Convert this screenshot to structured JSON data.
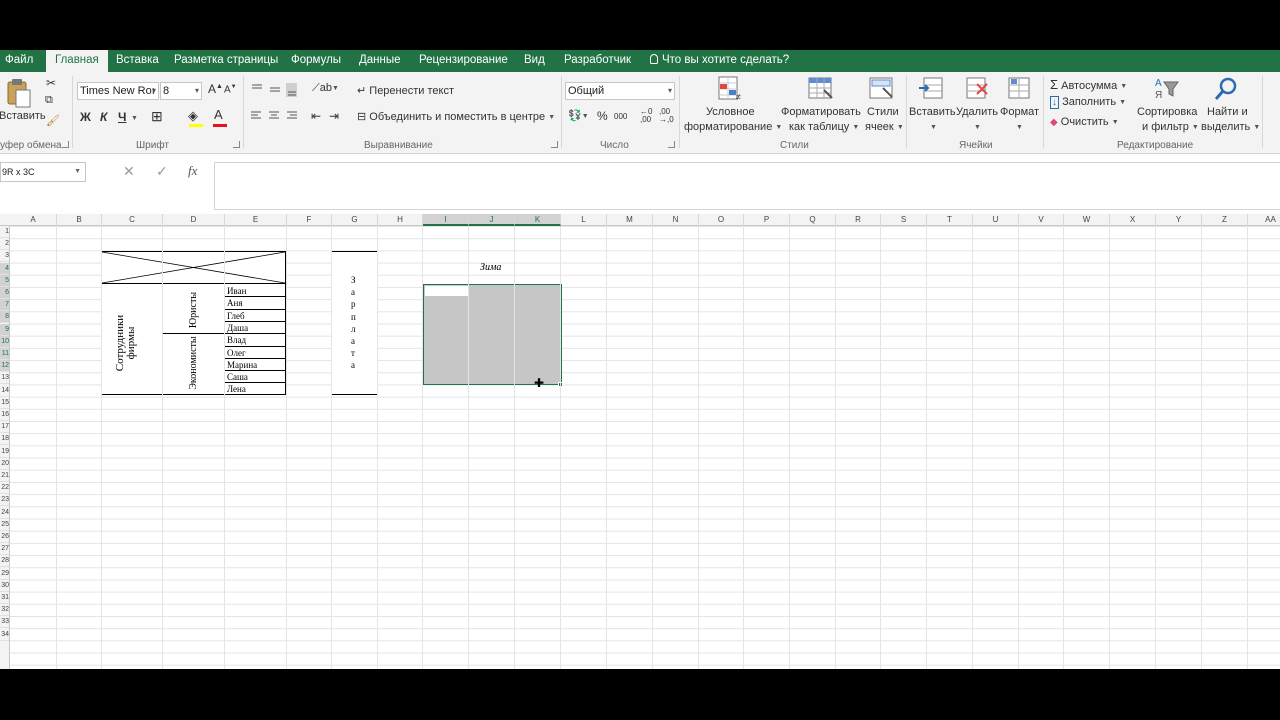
{
  "menu": {
    "tabs": [
      "Файл",
      "Главная",
      "Вставка",
      "Разметка страницы",
      "Формулы",
      "Данные",
      "Рецензирование",
      "Вид",
      "Разработчик"
    ],
    "active_index": 1,
    "tell_me": "Что вы хотите сделать?"
  },
  "ribbon": {
    "clipboard": {
      "paste": "Вставить",
      "group": "уфер обмена"
    },
    "font": {
      "name": "Times New Roı",
      "size": "8",
      "bold": "Ж",
      "italic": "К",
      "underline": "Ч",
      "group": "Шрифт"
    },
    "alignment": {
      "wrap": "Перенести текст",
      "merge": "Объединить и поместить в центре",
      "group": "Выравнивание"
    },
    "number": {
      "format": "Общий",
      "percent": "%",
      "thousands": "000",
      "group": "Число"
    },
    "styles": {
      "conditional_1": "Условное",
      "conditional_2": "форматирование",
      "format_table_1": "Форматировать",
      "format_table_2": "как таблицу",
      "cell_styles_1": "Стили",
      "cell_styles_2": "ячеек",
      "group": "Стили"
    },
    "cells": {
      "insert": "Вставить",
      "delete": "Удалить",
      "format": "Формат",
      "group": "Ячейки"
    },
    "editing": {
      "autosum": "Автосумма",
      "fill": "Заполнить",
      "clear": "Очистить",
      "sort_1": "Сортировка",
      "sort_2": "и фильтр",
      "find_1": "Найти и",
      "find_2": "выделить",
      "group": "Редактирование"
    }
  },
  "formula_bar": {
    "name_box": "9R x 3C",
    "cancel": "✕",
    "enter": "✓",
    "fx": "fx",
    "value": ""
  },
  "grid": {
    "columns": [
      "A",
      "B",
      "C",
      "D",
      "E",
      "F",
      "G",
      "H",
      "I",
      "J",
      "K",
      "L",
      "M",
      "N",
      "O",
      "P",
      "Q",
      "R",
      "S",
      "T",
      "U",
      "V",
      "W",
      "X",
      "Y",
      "Z",
      "AA"
    ],
    "selected_columns": [
      "I",
      "J",
      "K"
    ],
    "rows": [
      "1",
      "2",
      "3",
      "4",
      "5",
      "6",
      "7",
      "8",
      "9",
      "10",
      "11",
      "12",
      "13",
      "14",
      "15",
      "16",
      "17",
      "18",
      "19",
      "20",
      "21",
      "22",
      "23",
      "24",
      "25",
      "26",
      "27",
      "28",
      "29",
      "30",
      "31",
      "32",
      "33",
      "34"
    ],
    "selected_rows": [
      "4",
      "5",
      "6",
      "7",
      "8",
      "9",
      "10",
      "11",
      "12"
    ]
  },
  "table1": {
    "employees": "Сотрудники фирмы",
    "lawyers": "Юристы",
    "economists": "Экономисты",
    "names": [
      "Иван",
      "Аня",
      "Глеб",
      "Даша",
      "Влад",
      "Олег",
      "Марина",
      "Саша",
      "Лена"
    ]
  },
  "table2": {
    "salary_letters": [
      "З",
      "а",
      "р",
      "п",
      "л",
      "а",
      "т",
      "а"
    ]
  },
  "winter_label": "Зима",
  "colors": {
    "brand": "#217346",
    "selection": "#c6c6c6"
  }
}
